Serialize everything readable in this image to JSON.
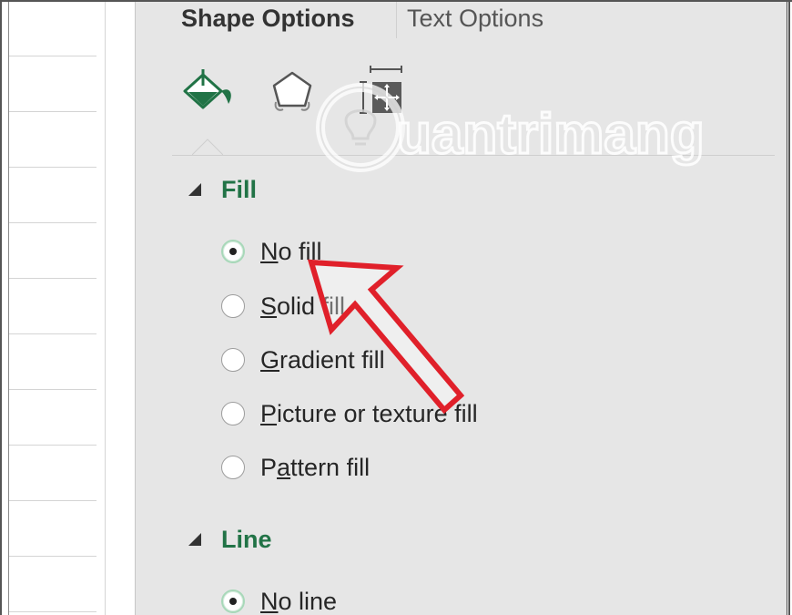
{
  "pane": {
    "tabs": [
      {
        "label": "Shape Options",
        "active": true
      },
      {
        "label": "Text Options",
        "active": false
      }
    ],
    "icons": [
      {
        "name": "paint-bucket-icon",
        "label": "Fill & Line",
        "active": true
      },
      {
        "name": "pentagon-icon",
        "label": "Effects",
        "active": false
      },
      {
        "name": "size-properties-icon",
        "label": "Size & Properties",
        "active": false
      }
    ],
    "sections": {
      "fill": {
        "title": "Fill",
        "options": [
          {
            "pre": "",
            "key": "N",
            "post": "o fill",
            "checked": true
          },
          {
            "pre": "",
            "key": "S",
            "post": "olid fill",
            "checked": false
          },
          {
            "pre": "",
            "key": "G",
            "post": "radient fill",
            "checked": false
          },
          {
            "pre": "",
            "key": "P",
            "post": "icture or texture fill",
            "checked": false
          },
          {
            "pre": "P",
            "key": "a",
            "post": "ttern fill",
            "checked": false
          }
        ]
      },
      "line": {
        "title": "Line",
        "options": [
          {
            "pre": "",
            "key": "N",
            "post": "o line",
            "checked": true
          }
        ]
      }
    }
  },
  "watermark": {
    "text": "uantrimang"
  },
  "colors": {
    "accent_green": "#217346",
    "pane_bg": "#e6e6e6",
    "annotation_red": "#e0202a"
  }
}
